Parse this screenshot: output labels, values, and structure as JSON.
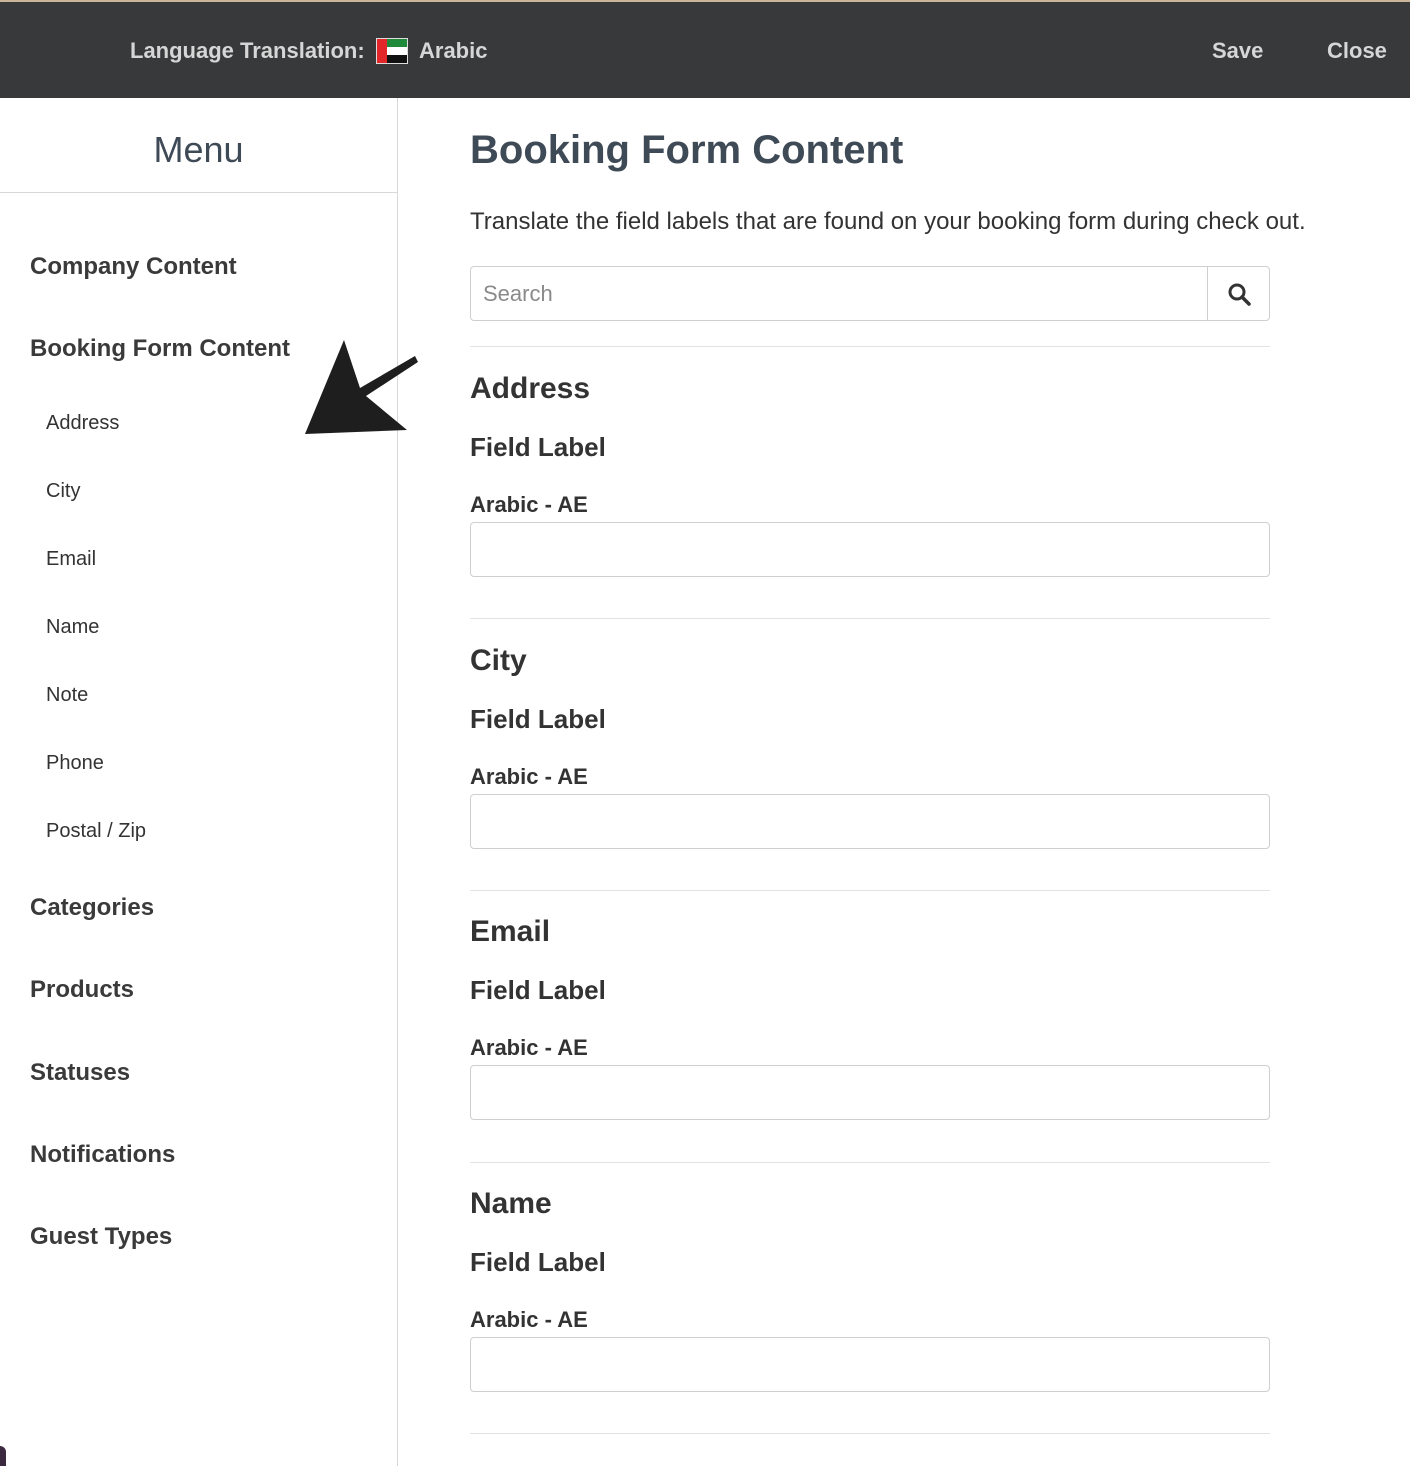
{
  "topbar": {
    "language_label": "Language Translation:",
    "language_value": "Arabic",
    "save_label": "Save",
    "close_label": "Close"
  },
  "sidebar": {
    "title": "Menu",
    "items": [
      {
        "label": "Company Content"
      },
      {
        "label": "Booking Form Content"
      },
      {
        "label": "Categories"
      },
      {
        "label": "Products"
      },
      {
        "label": "Statuses"
      },
      {
        "label": "Notifications"
      },
      {
        "label": "Guest Types"
      }
    ],
    "subitems": [
      {
        "label": "Address"
      },
      {
        "label": "City"
      },
      {
        "label": "Email"
      },
      {
        "label": "Name"
      },
      {
        "label": "Note"
      },
      {
        "label": "Phone"
      },
      {
        "label": "Postal / Zip"
      }
    ]
  },
  "main": {
    "title": "Booking Form Content",
    "description": "Translate the field labels that are found on your booking form during check out.",
    "search": {
      "placeholder": "Search",
      "value": ""
    },
    "sections": [
      {
        "title": "Address",
        "field_label": "Field Label",
        "lang_label": "Arabic - AE",
        "value": ""
      },
      {
        "title": "City",
        "field_label": "Field Label",
        "lang_label": "Arabic - AE",
        "value": ""
      },
      {
        "title": "Email",
        "field_label": "Field Label",
        "lang_label": "Arabic - AE",
        "value": ""
      },
      {
        "title": "Name",
        "field_label": "Field Label",
        "lang_label": "Arabic - AE",
        "value": ""
      }
    ]
  },
  "icons": {
    "search": "search-icon",
    "flag": "uae-flag-icon",
    "annotation": "arrow-annotation-icon"
  },
  "colors": {
    "topbar_bg": "#38393b",
    "topbar_text": "#d6d6d6",
    "title_color": "#3f4a57",
    "accent": "#2f76c5"
  }
}
